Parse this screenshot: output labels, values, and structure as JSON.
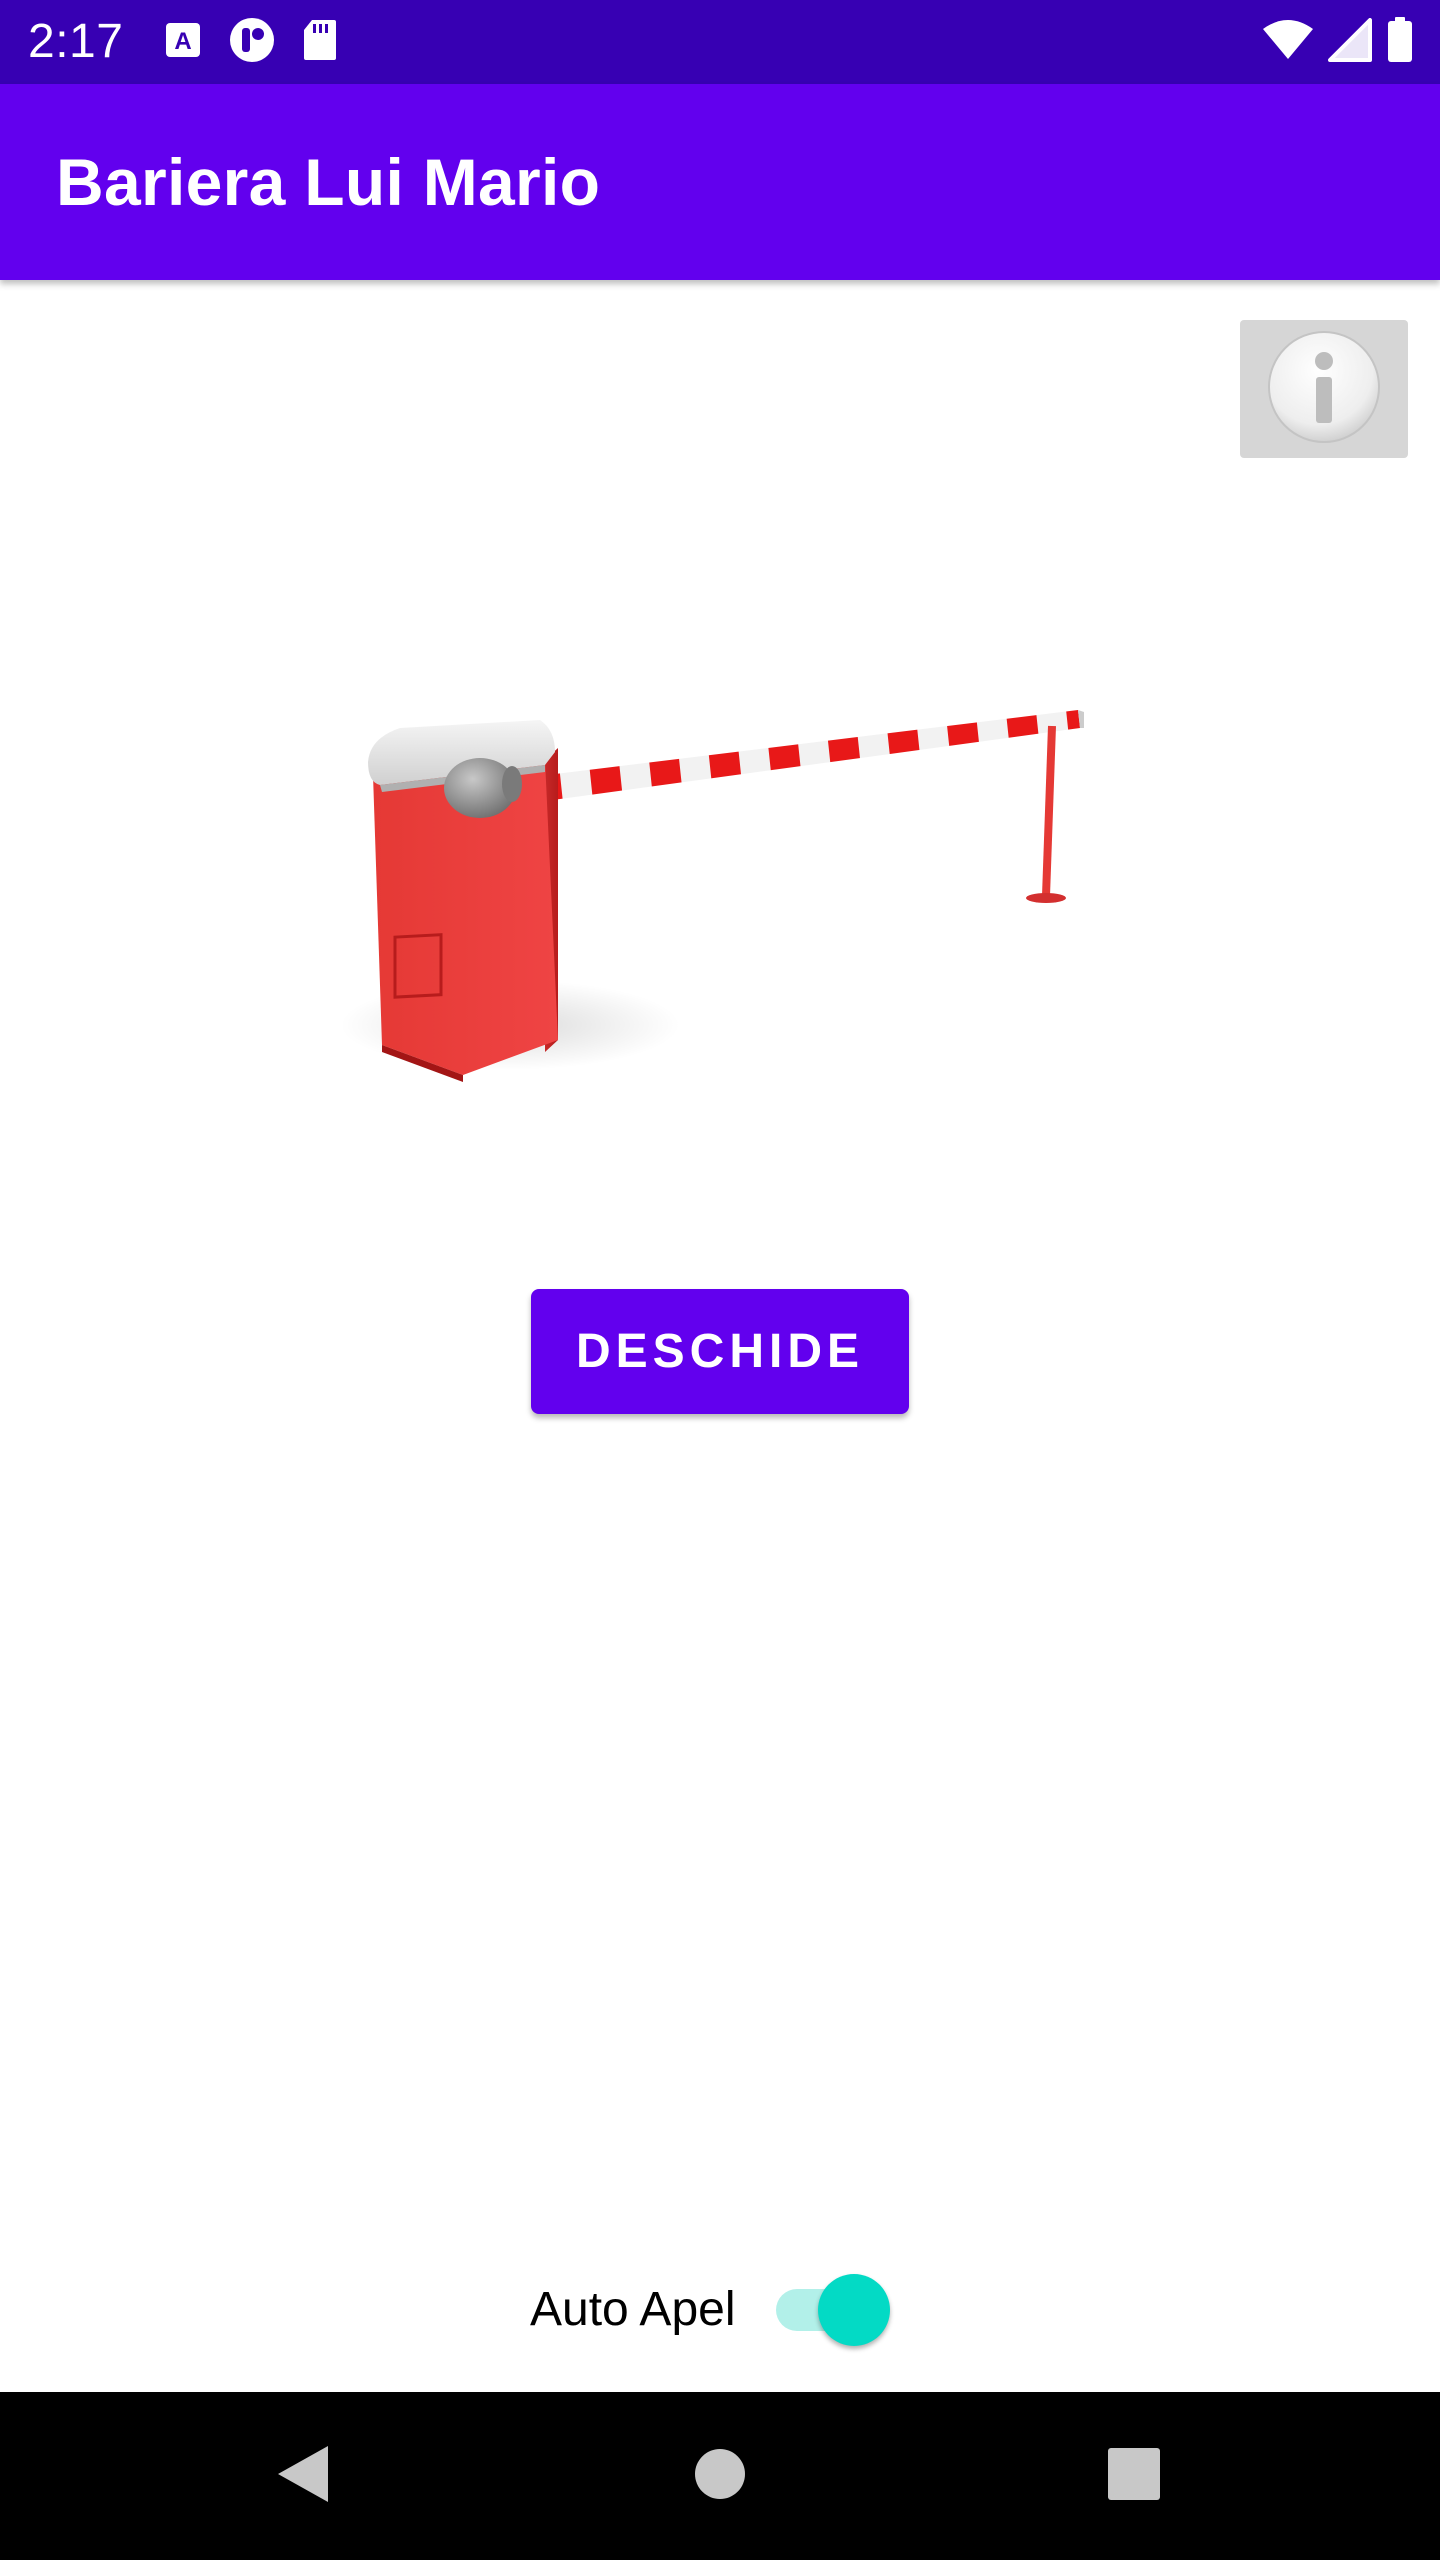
{
  "status_bar": {
    "time": "2:17",
    "left_icons": [
      "font-a-icon",
      "app-notification-icon",
      "sd-card-icon"
    ],
    "right_icons": [
      "wifi-icon",
      "cell-signal-icon",
      "battery-icon"
    ],
    "background": "#3700b3"
  },
  "app_bar": {
    "title": "Bariera Lui Mario",
    "background": "#6200ee"
  },
  "info_button": {
    "icon": "info-icon"
  },
  "barrier_image": {
    "icon": "parking-barrier-illustration"
  },
  "main": {
    "open_button_label": "DESCHIDE"
  },
  "auto_call": {
    "label": "Auto Apel",
    "enabled": true,
    "thumb_color": "#03dac5",
    "track_color": "#b2f0e9"
  },
  "nav_bar": {
    "buttons": [
      "back-icon",
      "home-icon",
      "recents-icon"
    ]
  }
}
